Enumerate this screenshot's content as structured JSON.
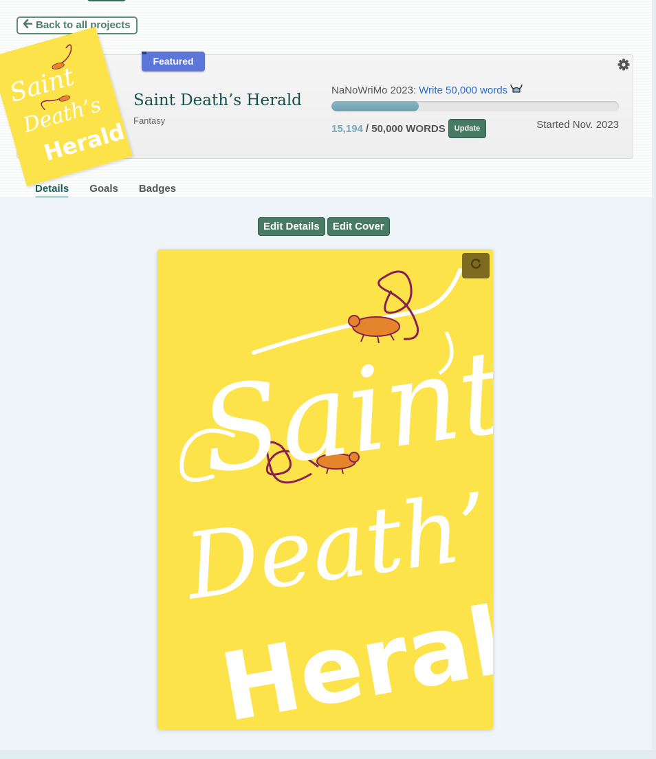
{
  "nav": {
    "back_label": "Back to all projects",
    "back_icon": "arrow-left-icon"
  },
  "project": {
    "badge": "Featured",
    "title": "Saint Death’s Herald",
    "genre": "Fantasy",
    "cover": {
      "line1": "Saint",
      "line2": "Death’s",
      "line3": "Herald",
      "background_color": "#fde34a",
      "lettering_color": "#ffffff"
    },
    "settings_icon": "gear-icon"
  },
  "goal": {
    "event_prefix": "NaNoWriMo 2023:",
    "goal_link": "Write 50,000 words",
    "goal_icon": "viking-helmet-icon",
    "current_words": "15,194",
    "target_words": "/ 50,000 WORDS",
    "update_label": "Update",
    "started": "Started Nov. 2023",
    "progress_fraction": 0.3039
  },
  "tabs": [
    {
      "label": "Details",
      "active": true
    },
    {
      "label": "Goals",
      "active": false
    },
    {
      "label": "Badges",
      "active": false
    }
  ],
  "actions": {
    "edit_details_label": "Edit Details",
    "edit_cover_label": "Edit Cover",
    "refresh_icon": "refresh-icon"
  },
  "colors": {
    "brand_green": "#497a66",
    "featured_blue": "#5b75d8",
    "link_blue": "#2a6ccd",
    "progress": "#7aa8b8"
  }
}
